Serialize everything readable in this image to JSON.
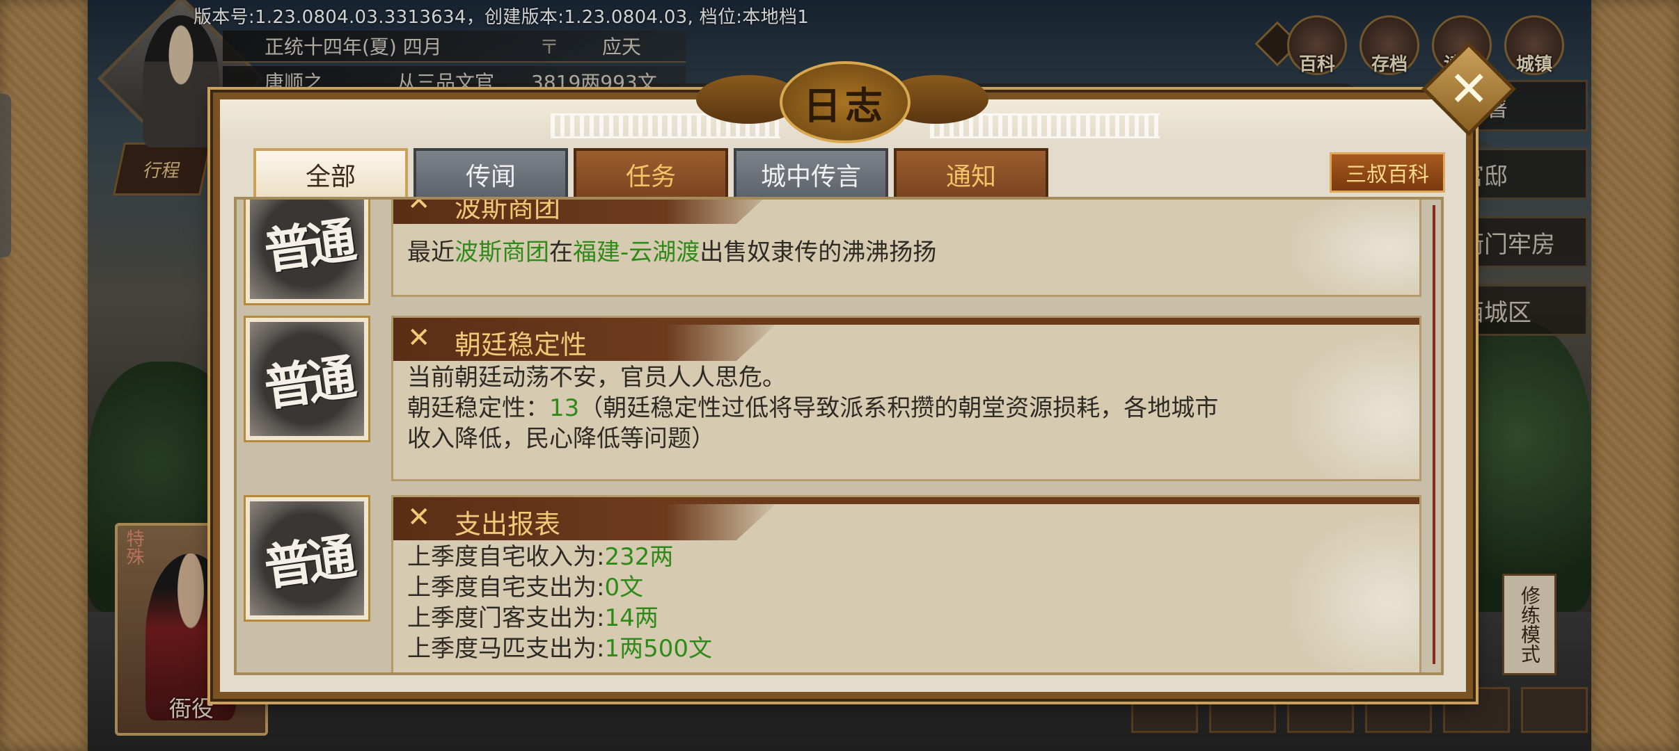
{
  "version_bar": {
    "text": "版本号:1.23.0804.03.3313634，创建版本:1.23.0804.03, 档位:本地档1"
  },
  "player": {
    "date": "正统十四年(夏) 四月",
    "city": "应天",
    "name": "唐顺之",
    "rank": "从三品文官",
    "money": "3819两993文",
    "left_tag": "行程"
  },
  "top_icons": [
    {
      "icon": "book-icon",
      "label": "百科"
    },
    {
      "icon": "save-icon",
      "label": "存档"
    },
    {
      "icon": "load-icon",
      "label": "读档"
    },
    {
      "icon": "town-icon",
      "label": "城镇"
    }
  ],
  "right_side_buttons": [
    "衙署",
    "官邸",
    "衙门牢房",
    "西城区"
  ],
  "bottom_card": {
    "label": "衙役",
    "stamp": "特殊"
  },
  "vertical_buttons": [
    "修练模式"
  ],
  "modal": {
    "title": "日志",
    "tabs": [
      {
        "label": "全部",
        "style": "active"
      },
      {
        "label": "传闻",
        "style": "grey"
      },
      {
        "label": "任务",
        "style": "brown"
      },
      {
        "label": "城中传言",
        "style": "grey"
      },
      {
        "label": "通知",
        "style": "brown"
      }
    ],
    "baike_button": "三叔百科",
    "badge_text": "普通",
    "entries": [
      {
        "title": "波斯商团",
        "lines": [
          [
            {
              "t": "最近"
            },
            {
              "t": "波斯商团",
              "c": "green"
            },
            {
              "t": "在"
            },
            {
              "t": "福建-云湖渡",
              "c": "green"
            },
            {
              "t": "出售奴隶传的沸沸扬扬"
            }
          ]
        ]
      },
      {
        "title": "朝廷稳定性",
        "lines": [
          [
            {
              "t": "当前朝廷动荡不安，官员人人思危。"
            }
          ],
          [
            {
              "t": "朝廷稳定性："
            },
            {
              "t": "13",
              "c": "green"
            },
            {
              "t": "（朝廷稳定性过低将导致派系积攒的朝堂资源损耗，各地城市"
            }
          ],
          [
            {
              "t": "收入降低，民心降低等问题）"
            }
          ]
        ]
      },
      {
        "title": "支出报表",
        "lines": [
          [
            {
              "t": "上季度自宅收入为:"
            },
            {
              "t": "232两",
              "c": "green"
            }
          ],
          [
            {
              "t": "上季度自宅支出为:"
            },
            {
              "t": "0文",
              "c": "green"
            }
          ],
          [
            {
              "t": "上季度门客支出为:"
            },
            {
              "t": "14两",
              "c": "green"
            }
          ],
          [
            {
              "t": "上季度马匹支出为:"
            },
            {
              "t": "1两500文",
              "c": "green"
            }
          ]
        ]
      }
    ]
  },
  "colors": {
    "accent_gold": "#f2c879",
    "value_green": "#2f8a1a",
    "frame_brown": "#7a5224"
  }
}
